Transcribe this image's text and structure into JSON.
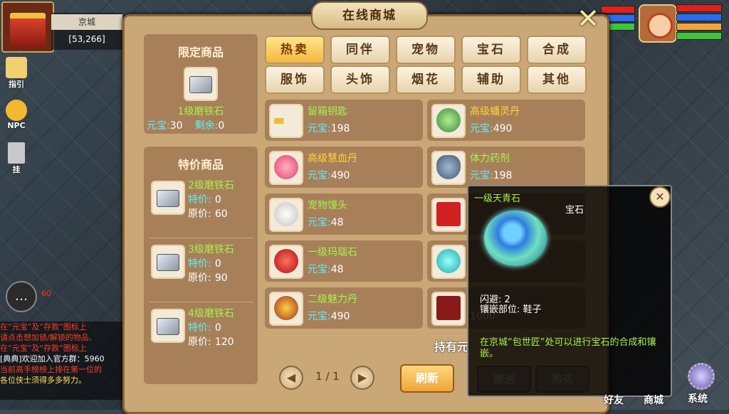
{
  "location": {
    "name": "京城",
    "coords": "[53,266]"
  },
  "side_buttons": [
    "指引",
    "NPC",
    "挂"
  ],
  "chat": {
    "bubble_icon": "speech-bubble-icon",
    "unread": "60",
    "lines": [
      "在“元宝”及“存款”图标上",
      "请点击想加锁/解锁的物品、",
      "在“元宝”及“存款”图标上",
      "[典典]欢迎加入官方群：5960",
      "当前高手榜榜上排在第一位的",
      "各位侠士须得多多努力。"
    ]
  },
  "shop": {
    "title": "在线商城",
    "limited": {
      "title": "限定商品",
      "item": {
        "name": "1级磨铁石",
        "currency_label": "元宝:",
        "price": "30",
        "remain_label": "剩余:",
        "remain": "0"
      }
    },
    "special": {
      "title": "特价商品",
      "items": [
        {
          "name": "2级磨铁石",
          "sale_label": "特价:",
          "sale": "0",
          "orig_label": "原价:",
          "orig": "60"
        },
        {
          "name": "3级磨铁石",
          "sale_label": "特价:",
          "sale": "0",
          "orig_label": "原价:",
          "orig": "90"
        },
        {
          "name": "4级磨铁石",
          "sale_label": "特价:",
          "sale": "0",
          "orig_label": "原价:",
          "orig": "120"
        }
      ]
    },
    "categories": [
      "热卖",
      "同伴",
      "宠物",
      "宝石",
      "合成",
      "服饰",
      "头饰",
      "烟花",
      "辅助",
      "其他"
    ],
    "active_category": "热卖",
    "products": [
      {
        "name": "留箱钥匙",
        "price_label": "元宝:",
        "price": "198",
        "color": "#a8f04a"
      },
      {
        "name": "高级蟠灵丹",
        "price_label": "元宝:",
        "price": "490",
        "color": "#ffd23a"
      },
      {
        "name": "高级慧血丹",
        "price_label": "元宝:",
        "price": "490",
        "color": "#ffd23a"
      },
      {
        "name": "体力药剂",
        "price_label": "元宝:",
        "price": "198",
        "color": "#a8f04a"
      },
      {
        "name": "宠物馒头",
        "price_label": "元宝:",
        "price": "48",
        "color": "#a8f04a"
      },
      {
        "name": "",
        "price_label": "",
        "price": "",
        "color": "#a8f04a"
      },
      {
        "name": "一级玛瑙石",
        "price_label": "元宝:",
        "price": "48",
        "color": "#a8f04a"
      },
      {
        "name": "",
        "price_label": "",
        "price": "",
        "color": "#a8f04a"
      },
      {
        "name": "二级魅力丹",
        "price_label": "元宝:",
        "price": "490",
        "color": "#a8f04a"
      },
      {
        "name": "",
        "price_label": "",
        "price": "1000",
        "color": "#a8f04a"
      }
    ],
    "pager": {
      "text": "1 / 1"
    },
    "refresh": "刷新",
    "holding": "持有元",
    "gift": "赠送",
    "buy": "购买"
  },
  "tooltip": {
    "name": "一级天青石",
    "type": "宝石",
    "stat": "闪避: 2",
    "slot": "镶嵌部位: 鞋子",
    "desc": "在京城“包世匠”处可以进行宝石的合成和镶嵌。"
  },
  "bottom_buttons": [
    "好友",
    "商城",
    "系统"
  ],
  "colors": {
    "hp": "#e0201a",
    "mp": "#2a6cf0",
    "exp": "#3ec43a",
    "gold": "#f0a53a"
  }
}
